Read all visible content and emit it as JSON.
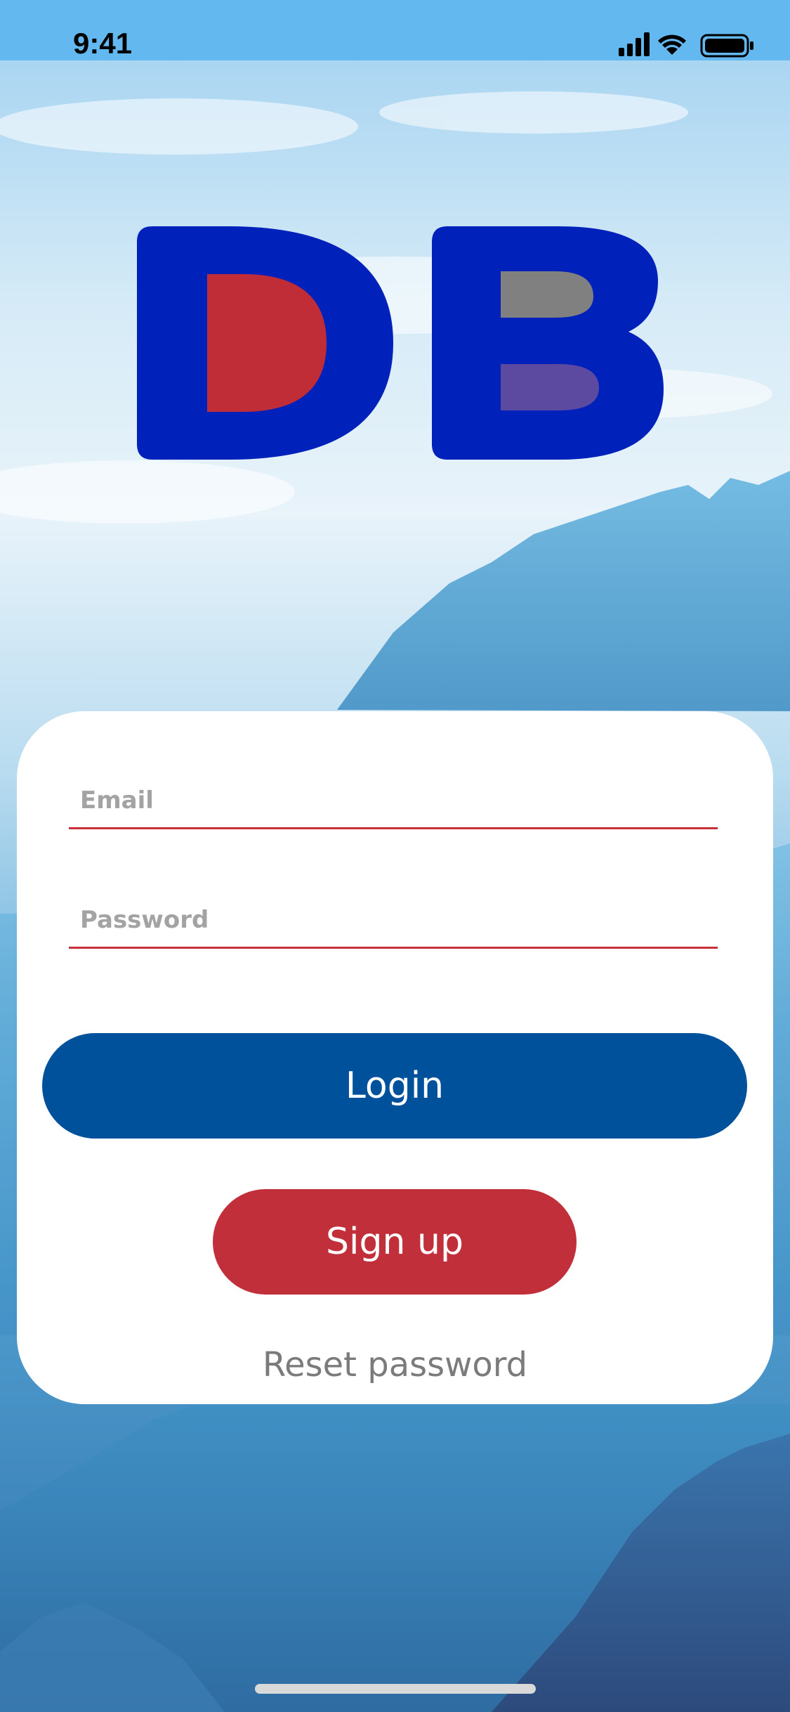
{
  "status_bar": {
    "time": "9:41",
    "icons": [
      "signal-icon",
      "wifi-icon",
      "battery-icon"
    ]
  },
  "logo": {
    "text": "DB",
    "colors": {
      "outline": "#0022bb",
      "d_fill": "#c12d36",
      "b_top": "#808080",
      "b_bottom": "#5b4aa0"
    }
  },
  "form": {
    "email_placeholder": "Email",
    "password_placeholder": "Password",
    "login_label": "Login",
    "signup_label": "Sign up",
    "reset_label": "Reset password"
  },
  "colors": {
    "login_button": "#00519c",
    "signup_button": "#c1303a",
    "field_underline": "#c8303a"
  }
}
